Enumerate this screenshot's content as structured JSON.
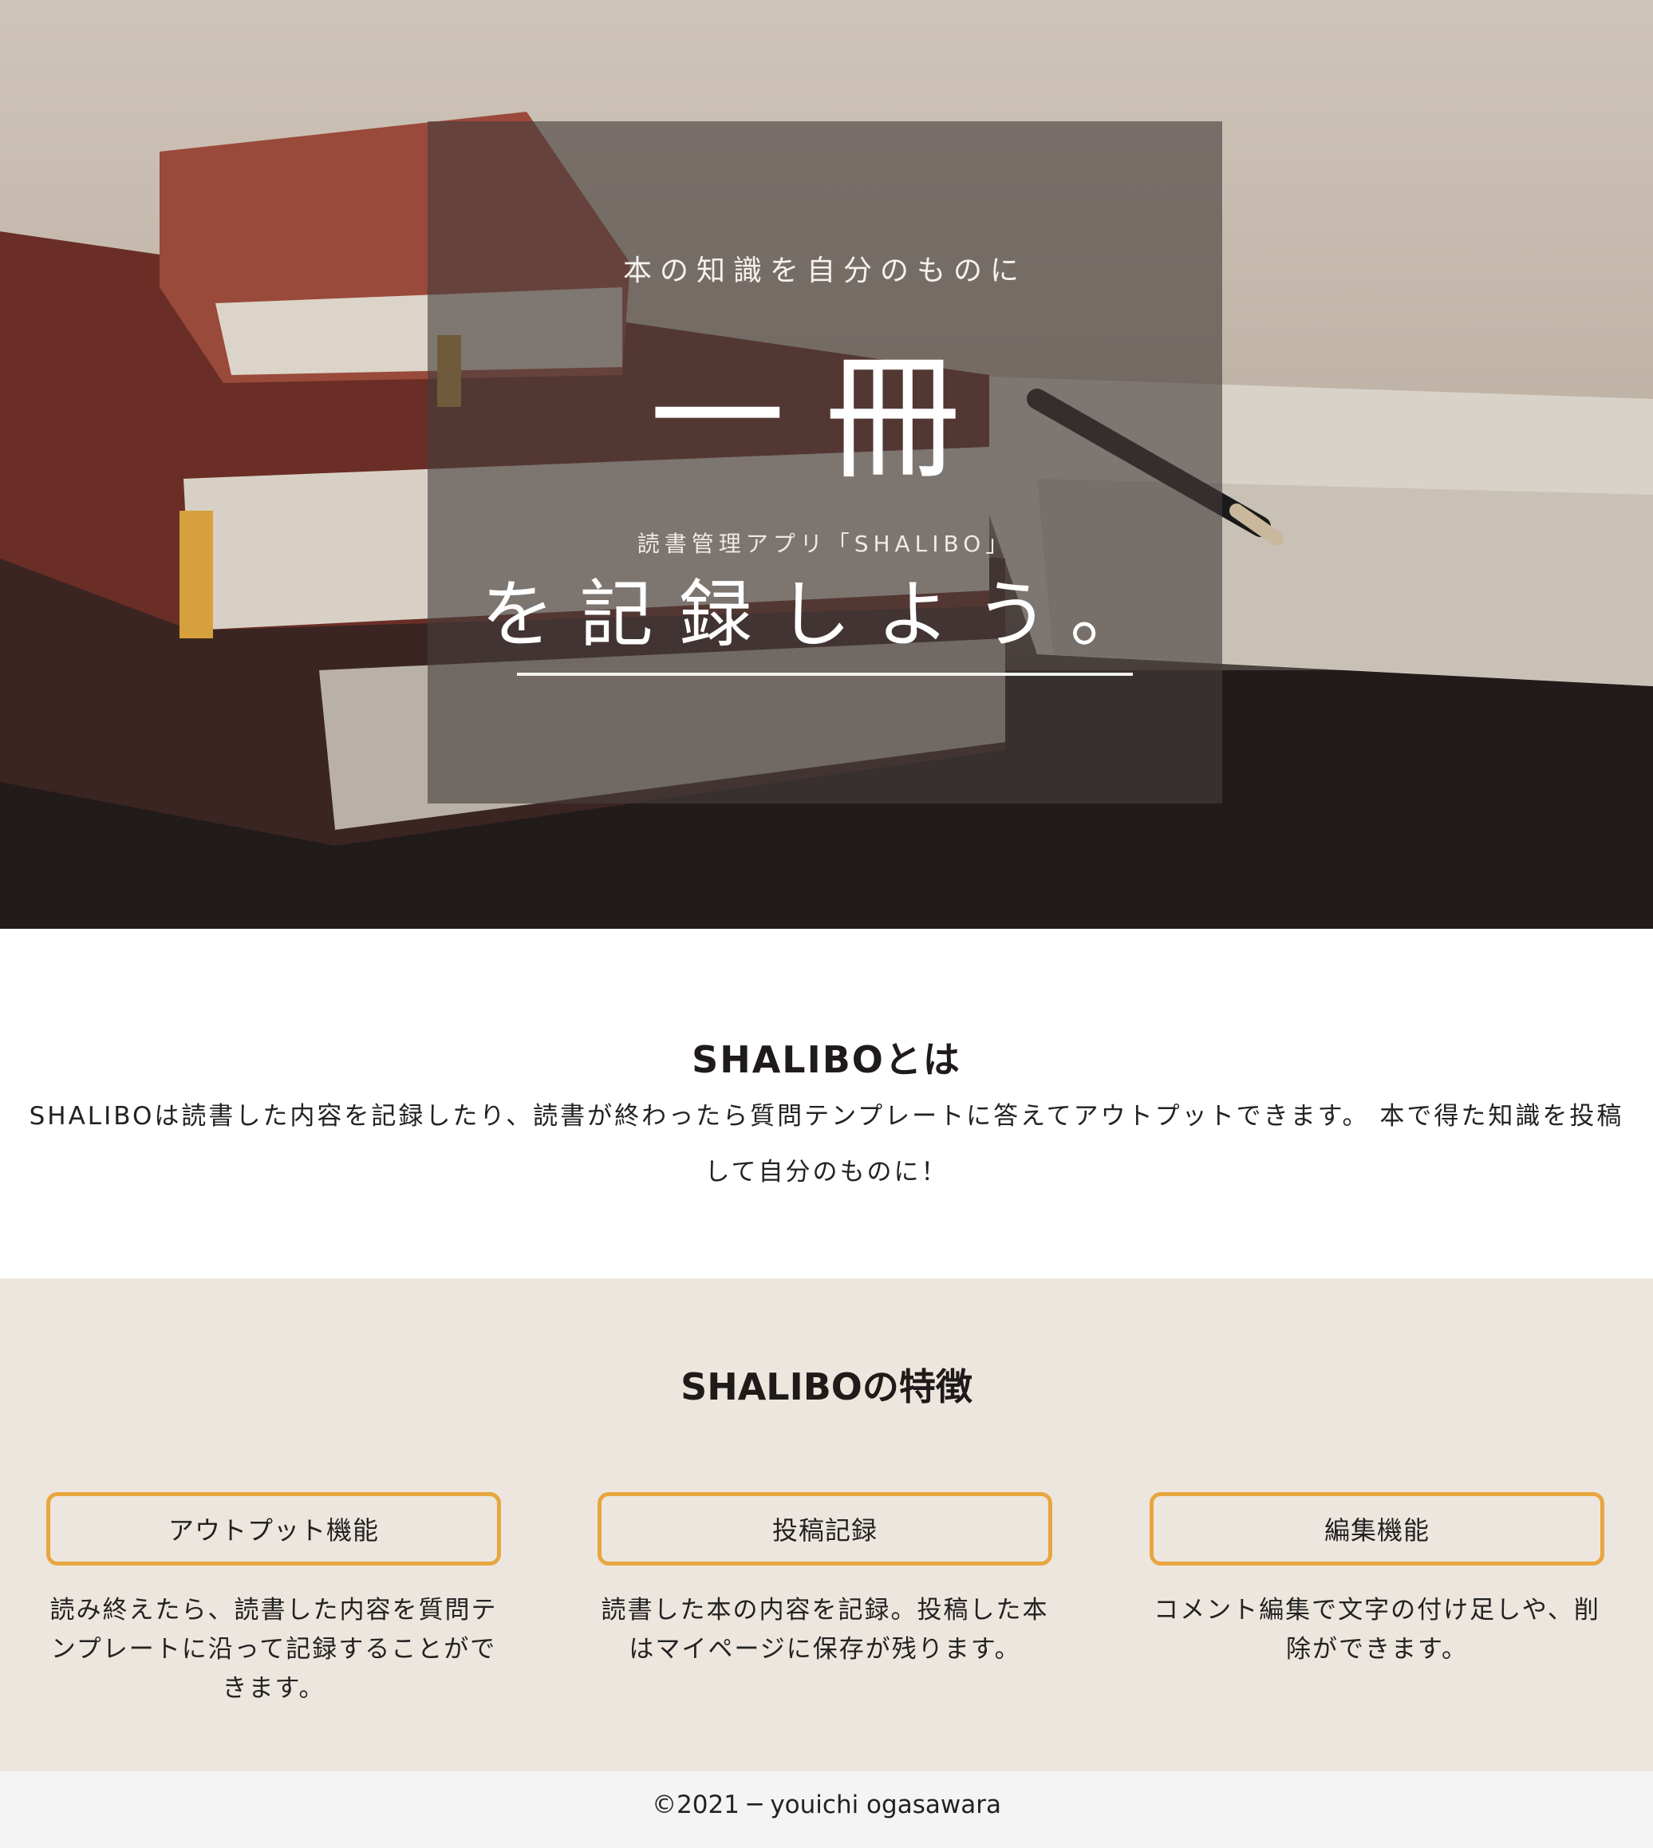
{
  "hero": {
    "tagline": "本の知識を自分のものに",
    "book_word": "一冊",
    "app_name": "読書管理アプリ「SHALIBO」",
    "headline": "を記録しよう。"
  },
  "about": {
    "title": "SHALIBOとは",
    "text_line1": "SHALIBOは読書した内容を記録したり、読書が終わったら質問テンプレートに答えてアウトプットできます。 本で得た知識を投稿",
    "text_line2": "して自分のものに！"
  },
  "features": {
    "title": "SHALIBOの特徴",
    "items": [
      {
        "label": "アウトプット機能",
        "desc_lines": [
          "読み終えたら、読書した内容を質問テ",
          "ンプレートに沿って記録することがで",
          "きます。"
        ]
      },
      {
        "label": "投稿記録",
        "desc_lines": [
          "読書した本の内容を記録。投稿した本",
          "はマイページに保存が残ります。"
        ]
      },
      {
        "label": "編集機能",
        "desc_lines": [
          "コメント編集で文字の付け足しや、削",
          "除ができます。"
        ]
      }
    ]
  },
  "footer": {
    "copyright": "©2021 ─ youichi ogasawara"
  },
  "colors": {
    "accent": "#e8a63f",
    "features_bg": "#ede6df",
    "footer_bg": "#f4f4f4"
  }
}
